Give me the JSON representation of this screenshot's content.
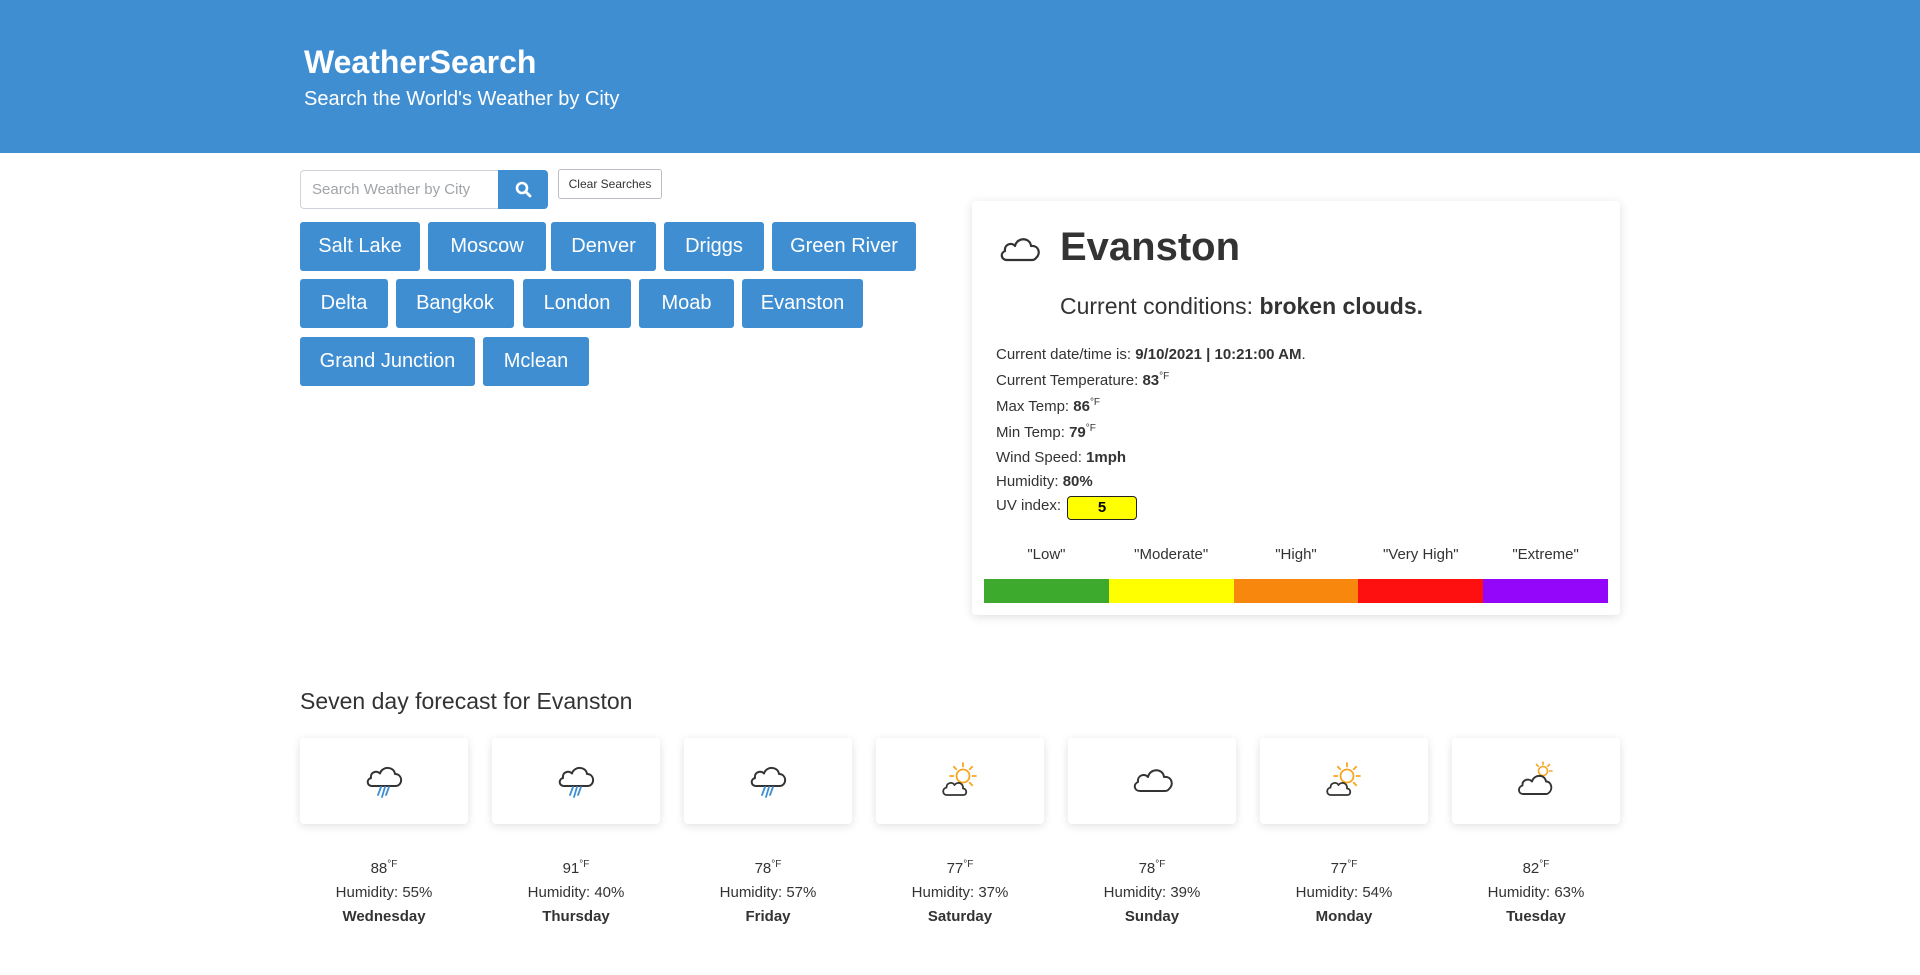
{
  "header": {
    "title": "WeatherSearch",
    "subtitle": "Search the World's Weather by City"
  },
  "search": {
    "placeholder": "Search Weather by City",
    "value": "",
    "clear_label": "Clear Searches"
  },
  "history": [
    "Salt Lake",
    "Moscow",
    "Denver",
    "Driggs",
    "Green River",
    "Delta",
    "Bangkok",
    "London",
    "Moab",
    "Evanston",
    "Grand Junction",
    "Mclean"
  ],
  "current": {
    "icon": "cloud-icon",
    "city": "Evanston",
    "conditions_prefix": "Current conditions: ",
    "conditions": "broken clouds.",
    "datetime_label": "Current date/time is: ",
    "datetime": "9/10/2021 | 10:21:00 AM",
    "datetime_suffix": ".",
    "temp_label": "Current Temperature: ",
    "temp": "83",
    "max_label": "Max Temp: ",
    "max": "86",
    "min_label": "Min Temp: ",
    "min": "79",
    "wind_label": "Wind Speed: ",
    "wind": "1mph",
    "humidity_label": "Humidity: ",
    "humidity": "80%",
    "uv_label": "UV index: ",
    "uv": "5",
    "unit": "°F",
    "uv_color": "#ffff00"
  },
  "uv_scale": {
    "labels": [
      "\"Low\"",
      "\"Moderate\"",
      "\"High\"",
      "\"Very High\"",
      "\"Extreme\""
    ],
    "colors": [
      "#3daa2d",
      "#ffff00",
      "#f8870e",
      "#ff1010",
      "#9406fa"
    ]
  },
  "forecast": {
    "title": "Seven day forecast for Evanston",
    "unit": "°F",
    "humidity_label": "Humidity: ",
    "days": [
      {
        "icon": "rain-cloud-icon",
        "temp": "88",
        "humidity": "55%",
        "day": "Wednesday"
      },
      {
        "icon": "rain-cloud-icon",
        "temp": "91",
        "humidity": "40%",
        "day": "Thursday"
      },
      {
        "icon": "rain-cloud-icon",
        "temp": "78",
        "humidity": "57%",
        "day": "Friday"
      },
      {
        "icon": "sun-cloud-icon",
        "temp": "77",
        "humidity": "37%",
        "day": "Saturday"
      },
      {
        "icon": "cloud-icon",
        "temp": "78",
        "humidity": "39%",
        "day": "Sunday"
      },
      {
        "icon": "sun-cloud-icon",
        "temp": "77",
        "humidity": "54%",
        "day": "Monday"
      },
      {
        "icon": "small-sun-cloud-icon",
        "temp": "82",
        "humidity": "63%",
        "day": "Tuesday"
      }
    ]
  },
  "colors": {
    "brand": "#3f8ed2",
    "text": "#333333",
    "sun": "#f5a623",
    "rain": "#3f8ed2"
  }
}
